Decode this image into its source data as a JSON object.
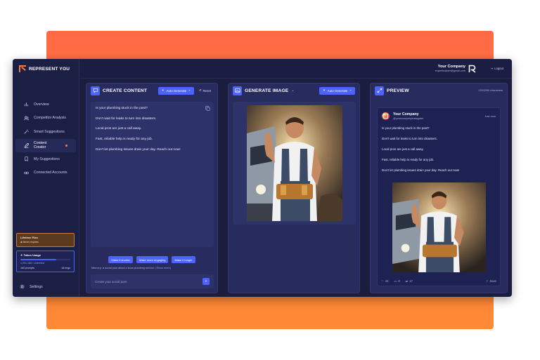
{
  "brand": {
    "name": "REPRESENT YOU"
  },
  "sidebar": {
    "items": [
      {
        "label": "Overview",
        "icon": "bar-chart-icon"
      },
      {
        "label": "Competitor Analysis",
        "icon": "users-icon"
      },
      {
        "label": "Smart Suggestions",
        "icon": "magic-wand-icon"
      },
      {
        "label": "Content Creator",
        "icon": "pencil-icon",
        "active": true
      },
      {
        "label": "My Suggestions",
        "icon": "bookmark-icon"
      },
      {
        "label": "Connected Accounts",
        "icon": "link-icon"
      }
    ],
    "plan": {
      "title": "Lifetime Plan",
      "subtitle": "Never expires"
    },
    "tokens": {
      "title": "Token Usage",
      "count": "1,091,168 / Unlimited",
      "prompts": "163 prompts",
      "imgs": "18 imgs",
      "fill_fraction": 0.72
    },
    "settings_label": "Settings"
  },
  "header": {
    "company_name": "Your Company",
    "company_email": "expertbuilder@gmail.com",
    "logout_label": "Logout"
  },
  "create_content": {
    "title": "CREATE CONTENT",
    "auto_generate_label": "Auto Generate",
    "reset_label": "Reset",
    "lines": [
      "Is your plumbing stuck in the past?",
      "Don't wait for leaks to turn into disasters.",
      "Local pros are just a call away.",
      "Fast, reliable help is ready for any job.",
      "Don't let plumbing issues drain your day. Reach out now!"
    ],
    "chips": [
      "Make it shorter",
      "Make more engaging",
      "Make it longer"
    ],
    "memory_text": "Memory: a social post about a local plumbing service.",
    "memory_link": "(Show more)",
    "input_placeholder": "Create your social post",
    "send_label": "+"
  },
  "generate_image": {
    "title": "GENERATE IMAGE",
    "auto_generate_label": "Auto Generate"
  },
  "preview": {
    "title": "PREVIEW",
    "char_count": "220/2200 characters",
    "account_name": "Your Company",
    "account_handle": "@yourcompanyinstagram",
    "time": "Just now",
    "likes": "42",
    "comments": "8",
    "shares": "17",
    "save_label": "Save"
  },
  "colors": {
    "accent": "#4c63ff",
    "brand_orange": "#ff7a3c",
    "app_bg": "#1a1d3e"
  }
}
